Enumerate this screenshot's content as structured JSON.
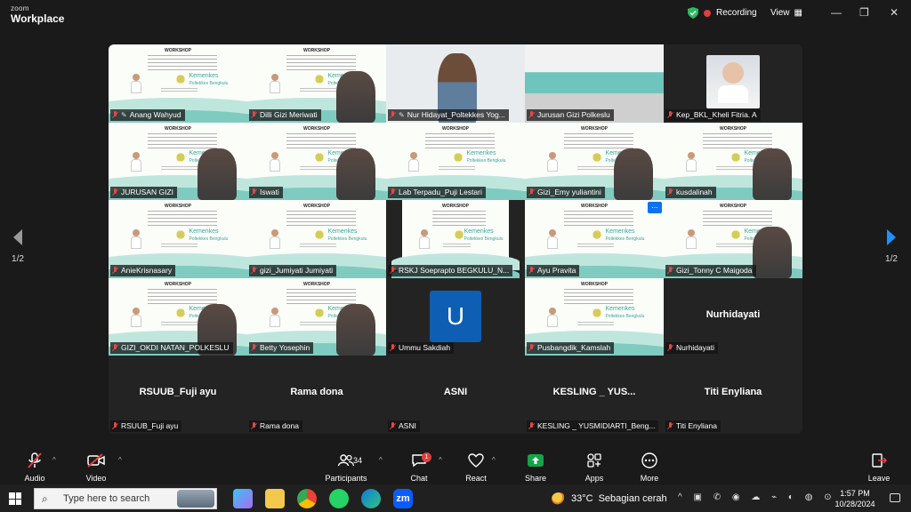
{
  "window": {
    "brand_line1": "zoom",
    "brand_line2": "Workplace",
    "recording_label": "Recording",
    "view_label": "View",
    "minimize_glyph": "—",
    "restore_glyph": "❐",
    "close_glyph": "✕"
  },
  "pages": {
    "left": "1/2",
    "right": "1/2"
  },
  "tiles": [
    {
      "name": "Anang Wahyud",
      "type": "slide",
      "pinned": true
    },
    {
      "name": "Dilli Gizi Meriwati",
      "type": "slide-cam",
      "active": true
    },
    {
      "name": "Nur Hidayat_Poltekkes Yog...",
      "type": "cam",
      "pinned": true
    },
    {
      "name": "Jurusan Gizi Polkeslu",
      "type": "room"
    },
    {
      "name": "Kep_BKL_Kheli Fitria. A",
      "type": "baby"
    },
    {
      "name": "JURUSAN GIZI",
      "type": "slide-cam"
    },
    {
      "name": "Iswati",
      "type": "slide-cam"
    },
    {
      "name": "Lab Terpadu_Puji Lestari",
      "type": "slide"
    },
    {
      "name": "Gizi_Emy yuliantini",
      "type": "slide-cam"
    },
    {
      "name": "kusdalinah",
      "type": "slide-cam"
    },
    {
      "name": "AnieKrisnasary",
      "type": "slide"
    },
    {
      "name": "gizi_Jumiyati Jumiyati",
      "type": "slide"
    },
    {
      "name": "RSKJ Soeprapto BEGKULU_N...",
      "type": "slide-small"
    },
    {
      "name": "Ayu Pravita",
      "type": "slide",
      "more": "..."
    },
    {
      "name": "Gizi_Tonny C Maigoda",
      "type": "slide-cam"
    },
    {
      "name": "GIZI_OKDI NATAN_POLKESLU",
      "type": "slide-cam"
    },
    {
      "name": "Betty Yosephin",
      "type": "slide-cam"
    },
    {
      "name": "Ummu Sakdiah",
      "type": "avatar",
      "avatar_letter": "U"
    },
    {
      "name": "Pusbangdik_Kamslah",
      "type": "slide"
    },
    {
      "name": "Nurhidayati",
      "type": "dark",
      "display": "Nurhidayati"
    },
    {
      "name": "RSUUB_Fuji ayu",
      "type": "dark",
      "display": "RSUUB_Fuji ayu"
    },
    {
      "name": "Rama dona",
      "type": "dark",
      "display": "Rama dona"
    },
    {
      "name": "ASNI",
      "type": "dark",
      "display": "ASNI"
    },
    {
      "name": "KESLING _ YUSMIDIARTI_Beng...",
      "type": "dark",
      "display": "KESLING _ YUS..."
    },
    {
      "name": "Titi Enyliana",
      "type": "dark",
      "display": "Titi Enyliana"
    }
  ],
  "slide": {
    "heading": "WORKSHOP",
    "logo_text_1": "Kemenkes",
    "logo_text_2": "Poltekkes Bengkulu"
  },
  "toolbar": {
    "audio": "Audio",
    "video": "Video",
    "participants": "Participants",
    "participants_count": "34",
    "chat": "Chat",
    "chat_badge": "1",
    "react": "React",
    "share": "Share",
    "apps": "Apps",
    "more": "More",
    "leave": "Leave"
  },
  "taskbar": {
    "search_placeholder": "Type here to search",
    "temperature": "33°C",
    "weather_text": "Sebagian cerah",
    "time": "1:57 PM",
    "date": "10/28/2024",
    "zoom_app": "zm"
  },
  "colors": {
    "accent_blue": "#0e72ed",
    "recording_red": "#e03e3e",
    "share_green": "#16a34a",
    "active_outline": "#2dd36f"
  }
}
